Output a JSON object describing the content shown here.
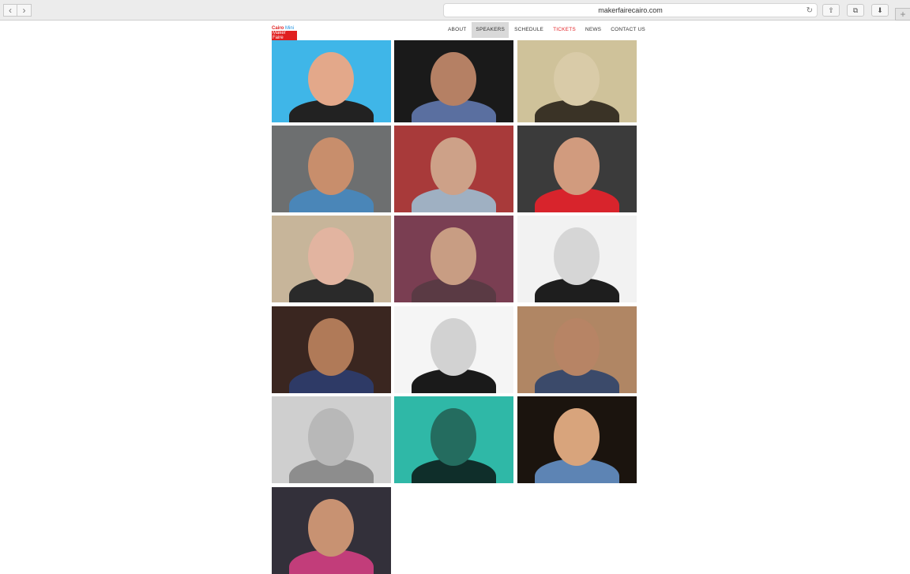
{
  "browser": {
    "url": "makerfairecairo.com",
    "back_icon": "chevron-left-icon",
    "forward_icon": "chevron-right-icon",
    "reload_icon": "reload-icon",
    "share_icon": "share-icon",
    "tabs_icon": "tabs-icon",
    "downloads_icon": "download-icon",
    "new_tab_icon": "plus-icon"
  },
  "site": {
    "logo_line1_a": "Cairo",
    "logo_line1_b": "Mini",
    "logo_line2": "Maker Faire",
    "nav": [
      {
        "label": "ABOUT"
      },
      {
        "label": "SPEAKERS",
        "active": true
      },
      {
        "label": "SCHEDULE"
      },
      {
        "label": "TICKETS",
        "color": "#e3262a"
      },
      {
        "label": "NEWS"
      },
      {
        "label": "CONTACT US"
      }
    ]
  },
  "speakers": [
    {
      "bg": "#3fb6e8",
      "skin": "#e3a88a",
      "shirt": "#222222"
    },
    {
      "bg": "#1a1a1a",
      "skin": "#b58064",
      "shirt": "#5a6fa0"
    },
    {
      "bg": "#cfc29a",
      "skin": "#d9cba8",
      "shirt": "#3a3326"
    },
    {
      "bg": "#6d6f70",
      "skin": "#c88e6c",
      "shirt": "#4a86b8"
    },
    {
      "bg": "#a83a3a",
      "skin": "#cda188",
      "shirt": "#9fb0c2"
    },
    {
      "bg": "#3b3b3b",
      "skin": "#d19b7e",
      "shirt": "#d8242c"
    },
    {
      "bg": "#c7b59a",
      "skin": "#e2b4a0",
      "shirt": "#2a2a2a"
    },
    {
      "bg": "#7a3e52",
      "skin": "#c89d83",
      "shirt": "#5a3a44"
    },
    {
      "bg": "#f2f2f2",
      "skin": "#d6d6d6",
      "shirt": "#1e1e1e"
    },
    {
      "bg": "#3a2620",
      "skin": "#b07a58",
      "shirt": "#2e3a66"
    },
    {
      "bg": "#f5f5f5",
      "skin": "#d2d2d2",
      "shirt": "#1a1a1a"
    },
    {
      "bg": "#b08664",
      "skin": "#b78465",
      "shirt": "#3b4a6a"
    },
    {
      "bg": "#cfcfcf",
      "skin": "#b8b8b8",
      "shirt": "#8d8d8d"
    },
    {
      "bg": "#2fb8a7",
      "skin": "#246c5f",
      "shirt": "#0f2e2a"
    },
    {
      "bg": "#1b140e",
      "skin": "#d8a47c",
      "shirt": "#5d84b4"
    },
    {
      "bg": "#33303a",
      "skin": "#c89272",
      "shirt": "#c23d7a"
    }
  ]
}
